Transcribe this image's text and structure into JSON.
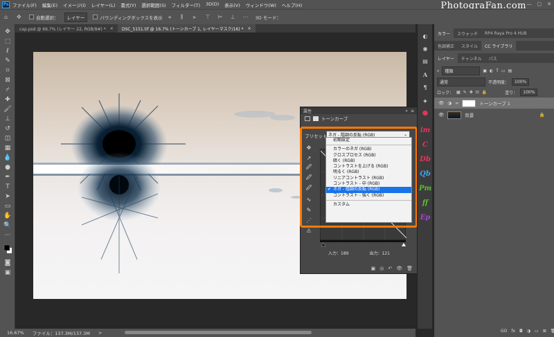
{
  "app": {
    "logo": "Ps",
    "watermark": "PhotograFan.com"
  },
  "menu": [
    "ファイル(F)",
    "編集(E)",
    "イメージ(I)",
    "レイヤー(L)",
    "書式(Y)",
    "選択範囲(S)",
    "フィルター(T)",
    "3D(D)",
    "表示(V)",
    "ウィンドウ(W)",
    "ヘルプ(H)"
  ],
  "window_controls": [
    "—",
    "▢",
    "✕"
  ],
  "options": {
    "auto_select": "自動選択：",
    "layer_dropdown": "レイヤー",
    "bbox": "バウンディングボックスを表示",
    "mode_3d": "3D モード："
  },
  "tabs": [
    {
      "label": "cap.psd @ 66.7% (レイヤー 22, RGB/8#) *",
      "close": "×"
    },
    {
      "label": "DSC_5151.tif @ 16.7% (トーンカーブ 1, レイヤーマスク/16) *",
      "close": "×"
    }
  ],
  "status": {
    "zoom": "16.67%",
    "file": "ファイル：137.3M/137.3M",
    "arrow": ">"
  },
  "properties": {
    "title": "属性",
    "collapse": "»",
    "menu": "≡",
    "subtitle": "トーンカーブ",
    "preset_label": "プリセット：",
    "preset_value": "ネガ - 階調の反転 (RGB)",
    "input_label": "入力：189",
    "output_label": "出力：121",
    "foot_icons": [
      "▣",
      "◎",
      "↶",
      "👁",
      "🗑"
    ],
    "tools": [
      "✥",
      "↗",
      "🖉",
      "🖉",
      "🖉",
      "∿",
      "✎",
      "⋰",
      "⚠"
    ]
  },
  "dropdown": {
    "items": [
      {
        "label": "初期設定",
        "sep_after": true
      },
      {
        "label": "カラーのネガ (RGB)"
      },
      {
        "label": "クロスプロセス (RGB)"
      },
      {
        "label": "暗く (RGB)"
      },
      {
        "label": "コントラストを上げる (RGB)"
      },
      {
        "label": "明るく (RGB)"
      },
      {
        "label": "リニアコントラスト (RGB)"
      },
      {
        "label": "コントラスト - 中 (RGB)"
      },
      {
        "label": "ネガ - 階調の反転 (RGB)",
        "selected": true,
        "check": "✔"
      },
      {
        "label": "コントラスト - 強く (RGB)",
        "sep_after": true
      },
      {
        "label": "カスタム"
      }
    ]
  },
  "panels": {
    "top_tabs": [
      "カラー",
      "スウォッチ",
      "RP4 Raya Pro 4 HUB"
    ],
    "mid_tabs": [
      "色調補正",
      "スタイル",
      "CC ライブラリ"
    ],
    "layer_tabs": [
      "レイヤー",
      "チャンネル",
      "パス"
    ],
    "filter_kind": "種類",
    "blend_mode": "通常",
    "opacity_label": "不透明度：",
    "opacity_value": "100%",
    "lock_label": "ロック：",
    "fill_label": "塗り：",
    "fill_value": "100%",
    "layers": [
      {
        "name": "トーンカーブ 1",
        "selected": true
      },
      {
        "name": "背景",
        "selected": false
      }
    ],
    "foot_icons": [
      "GO",
      "fx",
      "◘",
      "◑",
      "▭",
      "⊞",
      "🗑"
    ]
  },
  "strip": [
    {
      "label": "im",
      "color": "#e8355a"
    },
    {
      "label": "C",
      "color": "#e8355a"
    },
    {
      "label": "Db",
      "color": "#e8355a"
    },
    {
      "label": "Qb",
      "color": "#3fa4e8"
    },
    {
      "label": "Pm",
      "color": "#58c12f"
    },
    {
      "label": "ff",
      "color": "#58c12f"
    },
    {
      "label": "Ep",
      "color": "#a24ad1"
    }
  ]
}
